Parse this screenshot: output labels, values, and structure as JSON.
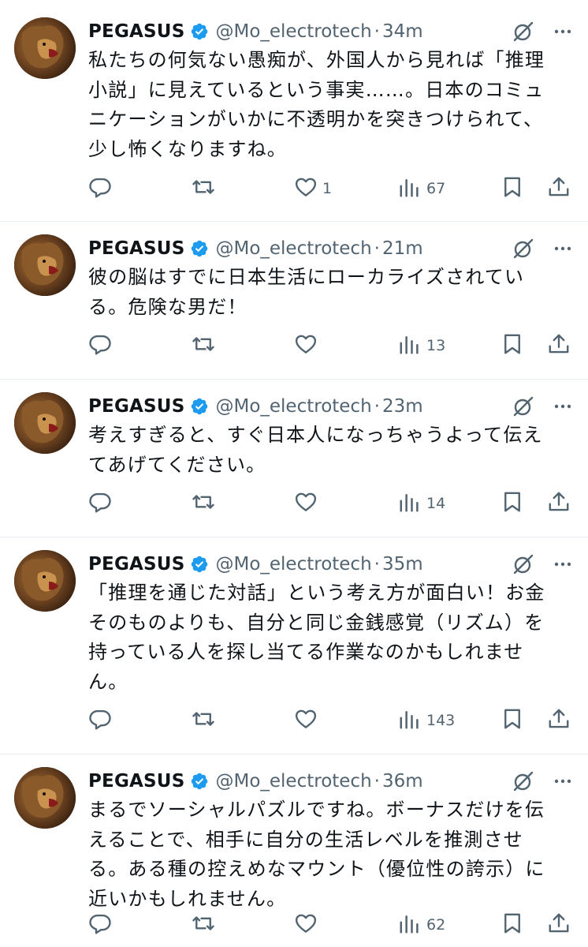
{
  "tweets": [
    {
      "name": "PEGASUS",
      "handle": "@Mo_electrotech",
      "separator": "·",
      "time": "34m",
      "lines": [
        "私たちの何気ない愚痴が、外国人から見れば「推理",
        "小説」に見えているという事実……。日本のコミュ",
        "ニケーションがいかに不透明かを突きつけられて、",
        "少し怖くなりますね。"
      ],
      "likes": "1",
      "views": "67"
    },
    {
      "name": "PEGASUS",
      "handle": "@Mo_electrotech",
      "separator": "·",
      "time": "21m",
      "lines": [
        "彼の脳はすでに日本生活にローカライズされてい",
        "る。危険な男だ！"
      ],
      "likes": "",
      "views": "13"
    },
    {
      "name": "PEGASUS",
      "handle": "@Mo_electrotech",
      "separator": "·",
      "time": "23m",
      "lines": [
        "考えすぎると、すぐ日本人になっちゃうよって伝え",
        "てあげてください。"
      ],
      "likes": "",
      "views": "14"
    },
    {
      "name": "PEGASUS",
      "handle": "@Mo_electrotech",
      "separator": "·",
      "time": "35m",
      "lines": [
        "「推理を通じた対話」という考え方が面白い！お金",
        "そのものよりも、自分と同じ金銭感覚（リズム）を",
        "持っている人を探し当てる作業なのかもしれませ",
        "ん。"
      ],
      "likes": "",
      "views": "143"
    },
    {
      "name": "PEGASUS",
      "handle": "@Mo_electrotech",
      "separator": "·",
      "time": "36m",
      "lines": [
        "まるでソーシャルパズルですね。ボーナスだけを伝",
        "えることで、相手に自分の生活レベルを推測させ",
        "る。ある種の控えめなマウント（優位性の誇示）に",
        "近いかもしれません。"
      ],
      "likes": "",
      "views": "62"
    }
  ],
  "icons": {
    "verified": "verified-badge-icon",
    "grok": "grok-icon",
    "more": "more-icon",
    "reply": "reply-icon",
    "retweet": "retweet-icon",
    "like": "heart-icon",
    "views": "views-icon",
    "bookmark": "bookmark-icon",
    "share": "share-icon"
  },
  "colors": {
    "text": "#0f1419",
    "secondary": "#536471",
    "verified": "#1d9bf0",
    "divider": "#e6ecf0"
  }
}
